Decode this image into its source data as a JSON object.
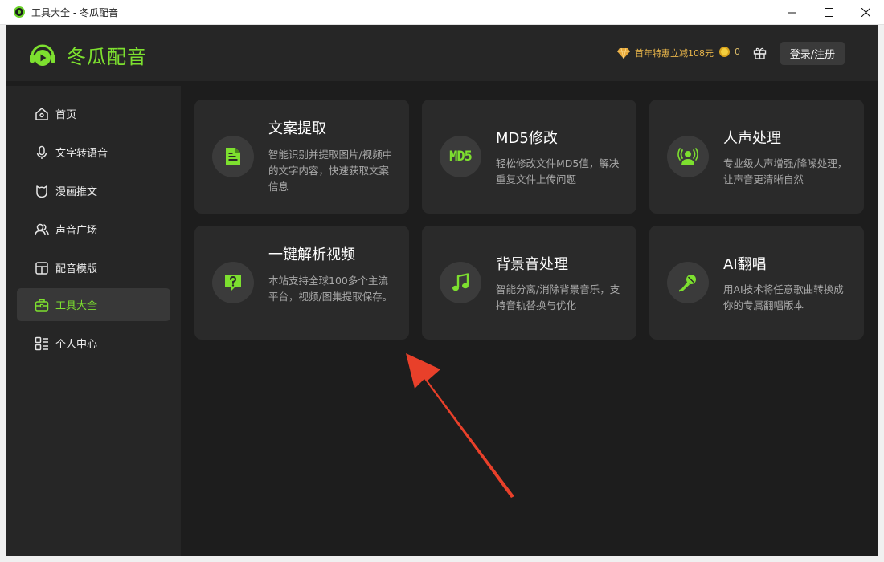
{
  "window": {
    "title": "工具大全 - 冬瓜配音",
    "controls": [
      "minimize",
      "maximize",
      "close"
    ]
  },
  "header": {
    "brand_name": "冬瓜配音",
    "promo_text": "首年特惠立减108元",
    "coin_count": "0",
    "login_label": "登录/注册"
  },
  "sidebar": {
    "items": [
      {
        "label": "首页",
        "icon": "home-icon"
      },
      {
        "label": "文字转语音",
        "icon": "microphone-icon"
      },
      {
        "label": "漫画推文",
        "icon": "shield-icon"
      },
      {
        "label": "声音广场",
        "icon": "users-icon"
      },
      {
        "label": "配音模版",
        "icon": "template-icon"
      },
      {
        "label": "工具大全",
        "icon": "toolbox-icon",
        "active": true
      },
      {
        "label": "个人中心",
        "icon": "profile-icon"
      }
    ]
  },
  "tools": [
    {
      "title": "文案提取",
      "desc": "智能识别并提取图片/视频中的文字内容，快速获取文案信息",
      "icon": "document-icon"
    },
    {
      "title": "MD5修改",
      "desc": "轻松修改文件MD5值，解决重复文件上传问题",
      "icon": "md5-icon",
      "icon_text": "MD5"
    },
    {
      "title": "人声处理",
      "desc": "专业级人声增强/降噪处理，让声音更清晰自然",
      "icon": "voice-icon"
    },
    {
      "title": "一键解析视频",
      "desc": "本站支持全球100多个主流平台，视频/图集提取保存。",
      "icon": "question-bubble-icon"
    },
    {
      "title": "背景音处理",
      "desc": "智能分离/消除背景音乐，支持音轨替换与优化",
      "icon": "music-note-icon"
    },
    {
      "title": "AI翻唱",
      "desc": "用AI技术将任意歌曲转换成你的专属翻唱版本",
      "icon": "mic-sing-icon"
    }
  ],
  "colors": {
    "accent": "#7de02f",
    "background": "#1d1d1d",
    "card": "#2a2a2a",
    "arrow": "#e8402a"
  }
}
